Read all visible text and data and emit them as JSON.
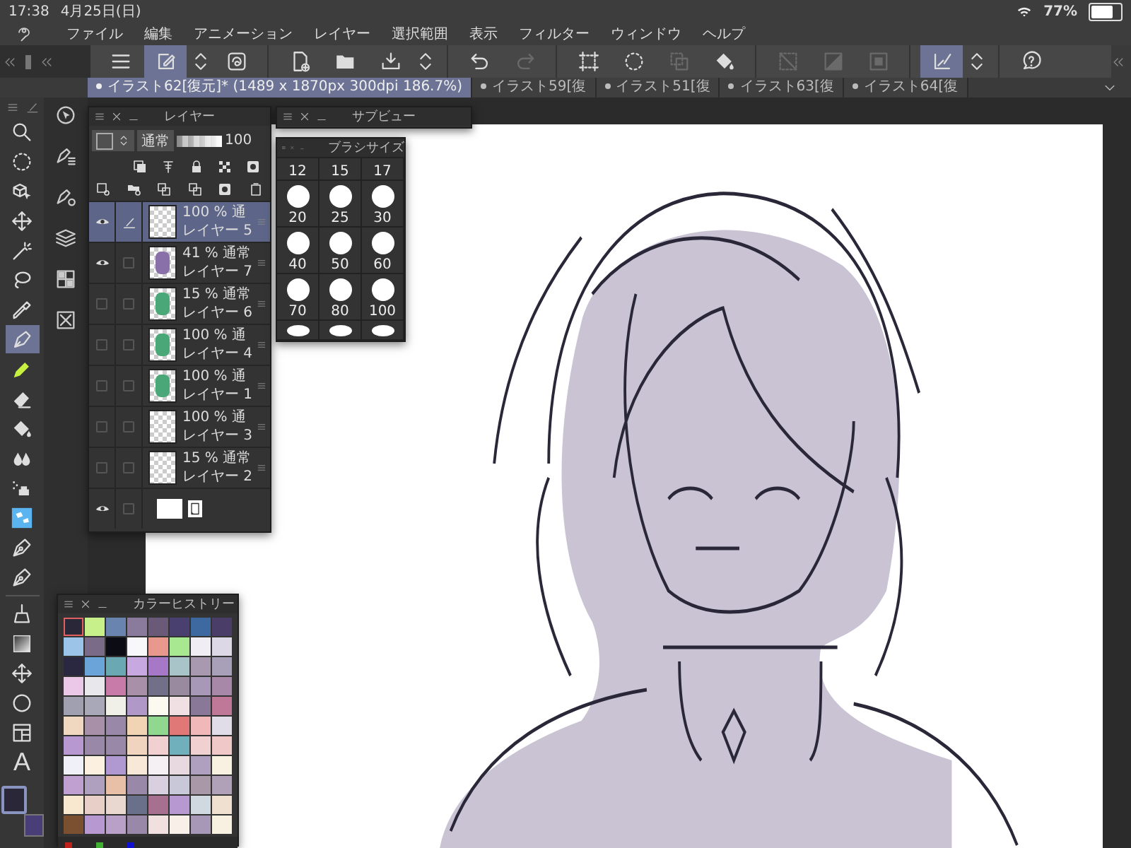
{
  "status_bar": {
    "time": "17:38",
    "date": "4月25日(日)",
    "battery": "77%"
  },
  "menu": [
    "ファイル",
    "編集",
    "アニメーション",
    "レイヤー",
    "選択範囲",
    "表示",
    "フィルター",
    "ウィンドウ",
    "ヘルプ"
  ],
  "toolbar": [
    {
      "kind": "menu",
      "selected": false,
      "disabled": false
    },
    {
      "kind": "edit",
      "selected": true,
      "disabled": false
    },
    {
      "kind": "stepper",
      "selected": false,
      "disabled": false
    },
    {
      "kind": "swirl",
      "selected": false,
      "disabled": false
    },
    {
      "kind": "separator"
    },
    {
      "kind": "new-document",
      "selected": false,
      "disabled": false
    },
    {
      "kind": "folder",
      "selected": false,
      "disabled": false
    },
    {
      "kind": "export",
      "selected": false,
      "disabled": false
    },
    {
      "kind": "stepper",
      "selected": false,
      "disabled": false
    },
    {
      "kind": "separator"
    },
    {
      "kind": "undo",
      "selected": false,
      "disabled": false
    },
    {
      "kind": "redo",
      "selected": false,
      "disabled": true
    },
    {
      "kind": "separator"
    },
    {
      "kind": "frame",
      "selected": false,
      "disabled": false
    },
    {
      "kind": "dotted-circle",
      "selected": false,
      "disabled": false
    },
    {
      "kind": "copy",
      "selected": false,
      "disabled": true
    },
    {
      "kind": "bucket",
      "selected": false,
      "disabled": false
    },
    {
      "kind": "separator"
    },
    {
      "kind": "clear",
      "selected": false,
      "disabled": true
    },
    {
      "kind": "invert",
      "selected": false,
      "disabled": true
    },
    {
      "kind": "square",
      "selected": false,
      "disabled": true
    },
    {
      "kind": "separator"
    },
    {
      "kind": "corner-check",
      "selected": true,
      "disabled": false
    },
    {
      "kind": "stepper",
      "selected": false,
      "disabled": false
    },
    {
      "kind": "separator"
    },
    {
      "kind": "help",
      "selected": false,
      "disabled": false
    }
  ],
  "tabs": [
    {
      "label": "イラスト62[復元]* (1489 x 1870px 300dpi 186.7%)",
      "selected": true
    },
    {
      "label": "イラスト59[復",
      "selected": false
    },
    {
      "label": "イラスト51[復",
      "selected": false
    },
    {
      "label": "イラスト63[復",
      "selected": false
    },
    {
      "label": "イラスト64[復",
      "selected": false
    }
  ],
  "tools": [
    {
      "kind": "magnifier",
      "selected": false
    },
    {
      "kind": "dotted-circle",
      "selected": false
    },
    {
      "kind": "cube-cursor",
      "selected": false
    },
    {
      "kind": "move",
      "selected": false
    },
    {
      "kind": "wand",
      "selected": false
    },
    {
      "kind": "lasso",
      "selected": false
    },
    {
      "kind": "dropper",
      "selected": false
    },
    {
      "kind": "pen",
      "selected": true
    },
    {
      "kind": "marker",
      "selected": false
    },
    {
      "kind": "eraser",
      "selected": false
    },
    {
      "kind": "bucket",
      "selected": false
    },
    {
      "kind": "drops",
      "selected": false
    },
    {
      "kind": "airbrush",
      "selected": false
    },
    {
      "kind": "decoration",
      "selected": false
    },
    {
      "kind": "nib",
      "selected": false
    },
    {
      "kind": "nib",
      "selected": false
    },
    {
      "kind": "broom",
      "selected": false
    },
    {
      "kind": "gradient",
      "selected": false
    },
    {
      "kind": "move",
      "selected": false
    },
    {
      "kind": "circle",
      "selected": false
    },
    {
      "kind": "layout",
      "selected": false
    },
    {
      "kind": "text",
      "glyph": "A",
      "selected": false
    }
  ],
  "color_slots": [
    {
      "kind": "main",
      "color": "#2a2838"
    },
    {
      "kind": "sub",
      "color": "#4a3e78"
    }
  ],
  "layer_panel": {
    "title": "レイヤー",
    "blend": "通常",
    "opacity": {
      "value": "100",
      "level": 1
    },
    "layers": [
      {
        "kind": "raster",
        "name": "レイヤー 5",
        "opacity": "100 %",
        "blend": "通",
        "visible": true,
        "editing": true,
        "selected": true
      },
      {
        "kind": "raster",
        "name": "レイヤー 7",
        "opacity": "41 %",
        "blend": "通常",
        "visible": true,
        "editing": false,
        "selected": false,
        "color": "#8a70a8"
      },
      {
        "kind": "raster",
        "name": "レイヤー 6",
        "opacity": "15 %",
        "blend": "通常",
        "visible": false,
        "editing": false,
        "selected": false,
        "color": "#4aa878"
      },
      {
        "kind": "raster",
        "name": "レイヤー 4",
        "opacity": "100 %",
        "blend": "通",
        "visible": false,
        "editing": false,
        "selected": false,
        "color": "#4aa878"
      },
      {
        "kind": "raster",
        "name": "レイヤー 1",
        "opacity": "100 %",
        "blend": "通",
        "visible": false,
        "editing": false,
        "selected": false,
        "color": "#4aa878"
      },
      {
        "kind": "raster",
        "name": "レイヤー 3",
        "opacity": "100 %",
        "blend": "通",
        "visible": false,
        "editing": false,
        "selected": false
      },
      {
        "kind": "raster",
        "name": "レイヤー 2",
        "opacity": "15 %",
        "blend": "通常",
        "visible": false,
        "editing": false,
        "selected": false
      },
      {
        "kind": "paper",
        "visible": true,
        "editing": false,
        "selected": false
      }
    ]
  },
  "subview": {
    "title": "サブビュー"
  },
  "brush_size": {
    "title": "ブラシサイズ",
    "sizes": [
      {
        "label": "12",
        "kind": "label"
      },
      {
        "label": "15",
        "kind": "label"
      },
      {
        "label": "17",
        "kind": "label"
      },
      {
        "label": "20",
        "kind": "dot"
      },
      {
        "label": "25",
        "kind": "dot"
      },
      {
        "label": "30",
        "kind": "dot"
      },
      {
        "label": "40",
        "kind": "dot"
      },
      {
        "label": "50",
        "kind": "dot"
      },
      {
        "label": "60",
        "kind": "dot"
      },
      {
        "label": "70",
        "kind": "dot"
      },
      {
        "label": "80",
        "kind": "dot"
      },
      {
        "label": "100",
        "kind": "dot"
      }
    ]
  },
  "color_history": {
    "title": "カラーヒストリー",
    "swatches": [
      {
        "color": "#2a2838",
        "selected": true
      },
      {
        "color": "#c8f08a",
        "selected": false
      },
      {
        "color": "#6a84b0",
        "selected": false
      },
      {
        "color": "#8a7a9c",
        "selected": false
      },
      {
        "color": "#6a5a78",
        "selected": false
      },
      {
        "color": "#4a4070",
        "selected": false
      },
      {
        "color": "#3e68a0",
        "selected": false
      },
      {
        "color": "#4a3e68",
        "selected": false
      },
      {
        "color": "#9cc4e8",
        "selected": false
      },
      {
        "color": "#7a6c88",
        "selected": false
      },
      {
        "color": "#0c0c14",
        "selected": false
      },
      {
        "color": "#f8f8fa",
        "selected": false
      },
      {
        "color": "#e8988c",
        "selected": false
      },
      {
        "color": "#a8e890",
        "selected": false
      },
      {
        "color": "#f0eef4",
        "selected": false
      },
      {
        "color": "#dcd8e6",
        "selected": false
      },
      {
        "color": "#2a2840",
        "selected": false
      },
      {
        "color": "#6aa4d8",
        "selected": false
      },
      {
        "color": "#6aa8b4",
        "selected": false
      },
      {
        "color": "#c8a8e0",
        "selected": false
      },
      {
        "color": "#a878c8",
        "selected": false
      },
      {
        "color": "#a8c4c8",
        "selected": false
      },
      {
        "color": "#a898b0",
        "selected": false
      },
      {
        "color": "#a8a0b8",
        "selected": false
      },
      {
        "color": "#ecc8e8",
        "selected": false
      },
      {
        "color": "#e8e8ec",
        "selected": false
      },
      {
        "color": "#c87aa8",
        "selected": false
      },
      {
        "color": "#a890a8",
        "selected": false
      },
      {
        "color": "#707088",
        "selected": false
      },
      {
        "color": "#9a8aa0",
        "selected": false
      },
      {
        "color": "#a898b8",
        "selected": false
      },
      {
        "color": "#a888a8",
        "selected": false
      },
      {
        "color": "#a0a0b0",
        "selected": false
      },
      {
        "color": "#a8a8b8",
        "selected": false
      },
      {
        "color": "#f0f0e8",
        "selected": false
      },
      {
        "color": "#b098c8",
        "selected": false
      },
      {
        "color": "#fcfaf0",
        "selected": false
      },
      {
        "color": "#f0e0e4",
        "selected": false
      },
      {
        "color": "#8a7898",
        "selected": false
      },
      {
        "color": "#c07898",
        "selected": false
      },
      {
        "color": "#f0d8c0",
        "selected": false
      },
      {
        "color": "#a890a8",
        "selected": false
      },
      {
        "color": "#9a88a8",
        "selected": false
      },
      {
        "color": "#f0d4b4",
        "selected": false
      },
      {
        "color": "#90d890",
        "selected": false
      },
      {
        "color": "#e07878",
        "selected": false
      },
      {
        "color": "#f0b8b8",
        "selected": false
      },
      {
        "color": "#e0dce8",
        "selected": false
      },
      {
        "color": "#b898d0",
        "selected": false
      },
      {
        "color": "#9a88a8",
        "selected": false
      },
      {
        "color": "#9a88a8",
        "selected": false
      },
      {
        "color": "#f0d4c0",
        "selected": false
      },
      {
        "color": "#f0d0d0",
        "selected": false
      },
      {
        "color": "#70b0bc",
        "selected": false
      },
      {
        "color": "#f0d0d0",
        "selected": false
      },
      {
        "color": "#f0c8c8",
        "selected": false
      },
      {
        "color": "#f0f0f8",
        "selected": false
      },
      {
        "color": "#fcf0e0",
        "selected": false
      },
      {
        "color": "#b098d0",
        "selected": false
      },
      {
        "color": "#f8e8d8",
        "selected": false
      },
      {
        "color": "#f4f0f4",
        "selected": false
      },
      {
        "color": "#e8d8e0",
        "selected": false
      },
      {
        "color": "#b0a0c0",
        "selected": false
      },
      {
        "color": "#f8f0e0",
        "selected": false
      },
      {
        "color": "#c0a0d0",
        "selected": false
      },
      {
        "color": "#b0a0c0",
        "selected": false
      },
      {
        "color": "#e8c0a8",
        "selected": false
      },
      {
        "color": "#9a88a8",
        "selected": false
      },
      {
        "color": "#d8d0e0",
        "selected": false
      },
      {
        "color": "#c8c8d8",
        "selected": false
      },
      {
        "color": "#a898a8",
        "selected": false
      },
      {
        "color": "#b0a0b8",
        "selected": false
      },
      {
        "color": "#f8e8d0",
        "selected": false
      },
      {
        "color": "#e8d0c8",
        "selected": false
      },
      {
        "color": "#e8d8d0",
        "selected": false
      },
      {
        "color": "#6a708a",
        "selected": false
      },
      {
        "color": "#a87090",
        "selected": false
      },
      {
        "color": "#b898d0",
        "selected": false
      },
      {
        "color": "#d0d8e0",
        "selected": false
      },
      {
        "color": "#f0e0d0",
        "selected": false
      },
      {
        "color": "#7a5030",
        "selected": false
      },
      {
        "color": "#b898d0",
        "selected": false
      },
      {
        "color": "#b8a0c8",
        "selected": false
      },
      {
        "color": "#9a88a8",
        "selected": false
      },
      {
        "color": "#f0e0e0",
        "selected": false
      },
      {
        "color": "#f8f0e8",
        "selected": false
      },
      {
        "color": "#a898b8",
        "selected": false
      },
      {
        "color": "#f8f0e0",
        "selected": false
      }
    ],
    "presets": [
      {
        "color": "#c0201c"
      },
      {
        "color": "#40b030"
      },
      {
        "color": "#1010d0"
      }
    ]
  }
}
